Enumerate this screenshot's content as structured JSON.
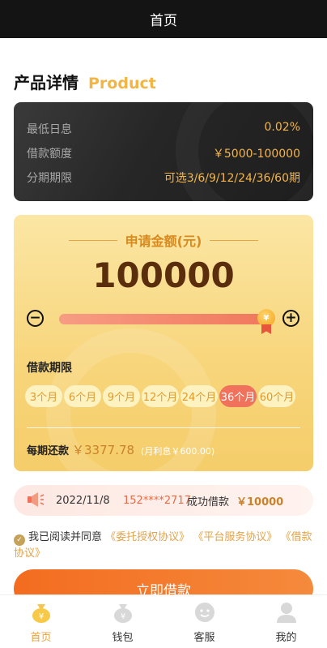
{
  "header": {
    "title": "首页"
  },
  "section": {
    "title_cn": "产品详情",
    "title_en": "Product"
  },
  "info": {
    "rows": [
      {
        "label": "最低日息",
        "value": "0.02%"
      },
      {
        "label": "借款额度",
        "value": "￥5000-100000"
      },
      {
        "label": "分期期限",
        "value": "可选3/6/9/12/24/36/60期"
      }
    ]
  },
  "apply": {
    "title": "申请金额(元)",
    "amount": "100000",
    "slider_level": 1.0,
    "minus_symbol": "−",
    "plus_symbol": "+",
    "knob_symbol": "¥",
    "term_label": "借款期限",
    "terms": [
      {
        "label": "3个月",
        "active": false
      },
      {
        "label": "6个月",
        "active": false
      },
      {
        "label": "9个月",
        "active": false
      },
      {
        "label": "12个月",
        "active": false
      },
      {
        "label": "24个月",
        "active": false
      },
      {
        "label": "36个月",
        "active": true
      },
      {
        "label": "60个月",
        "active": false
      }
    ],
    "repay_label": "每期还款",
    "repay_value": "￥3377.78",
    "interest_note": "(月利息￥600.00)"
  },
  "ticker": {
    "date": "2022/11/8",
    "phone": "152****2717",
    "message": "成功借款",
    "amount": "￥10000"
  },
  "agreement": {
    "check_symbol": "✓",
    "prefix": "我已阅读并同意",
    "links": [
      "《委托授权协议》",
      "《平台服务协议》",
      "《借款协议》"
    ]
  },
  "button": {
    "label": "立即借款"
  },
  "nav": {
    "items": [
      {
        "label": "首页",
        "icon": "money-bag-icon",
        "active": true
      },
      {
        "label": "钱包",
        "icon": "wallet-icon",
        "active": false
      },
      {
        "label": "客服",
        "icon": "customer-service-icon",
        "active": false
      },
      {
        "label": "我的",
        "icon": "user-icon",
        "active": false
      }
    ]
  },
  "colors": {
    "accent": "#f2b544",
    "active_term": "#f0725c",
    "button": "#f36c20",
    "nav_active": "#e9a33b"
  }
}
